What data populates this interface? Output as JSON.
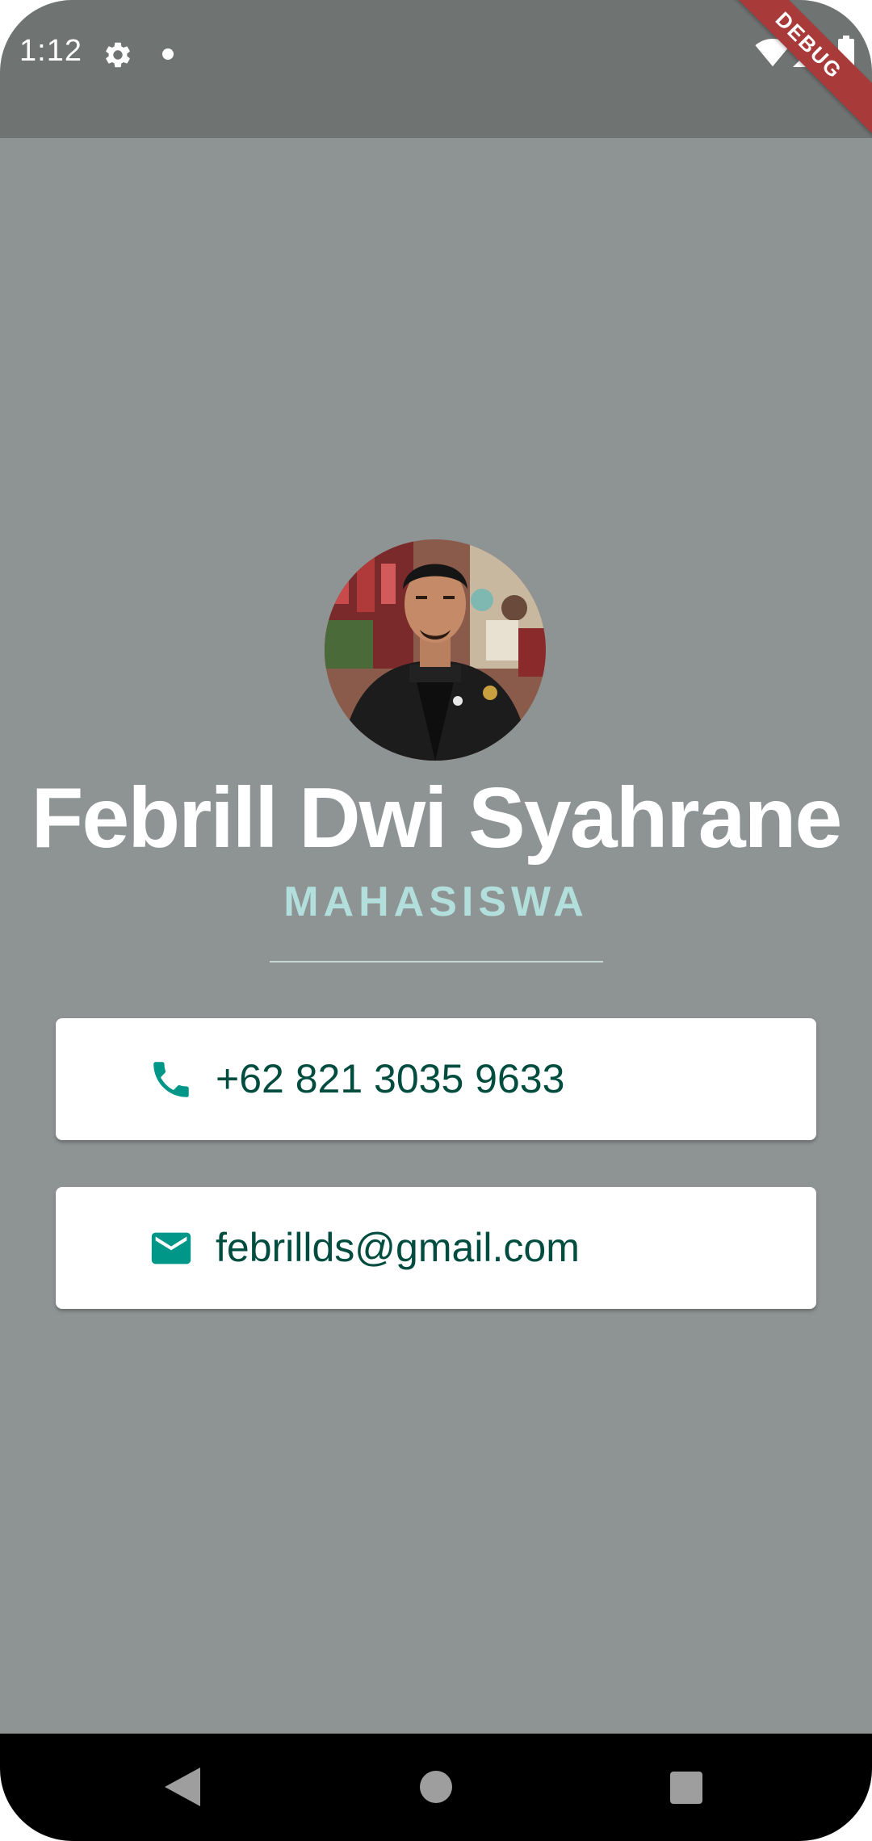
{
  "status_bar": {
    "time": "1:12",
    "debug_label": "DEBUG"
  },
  "profile": {
    "name": "Febrill Dwi Syahrane",
    "role": "MAHASISWA"
  },
  "contacts": [
    {
      "icon": "phone-icon",
      "text": "+62 821 3035 9633"
    },
    {
      "icon": "mail-icon",
      "text": "febrillds@gmail.com"
    }
  ],
  "colors": {
    "background": "#8e9393",
    "status_bar": "#6f7371",
    "accent_teal": "#009688",
    "text_dark_teal": "#004d40",
    "role_text": "#b2dfdb"
  }
}
